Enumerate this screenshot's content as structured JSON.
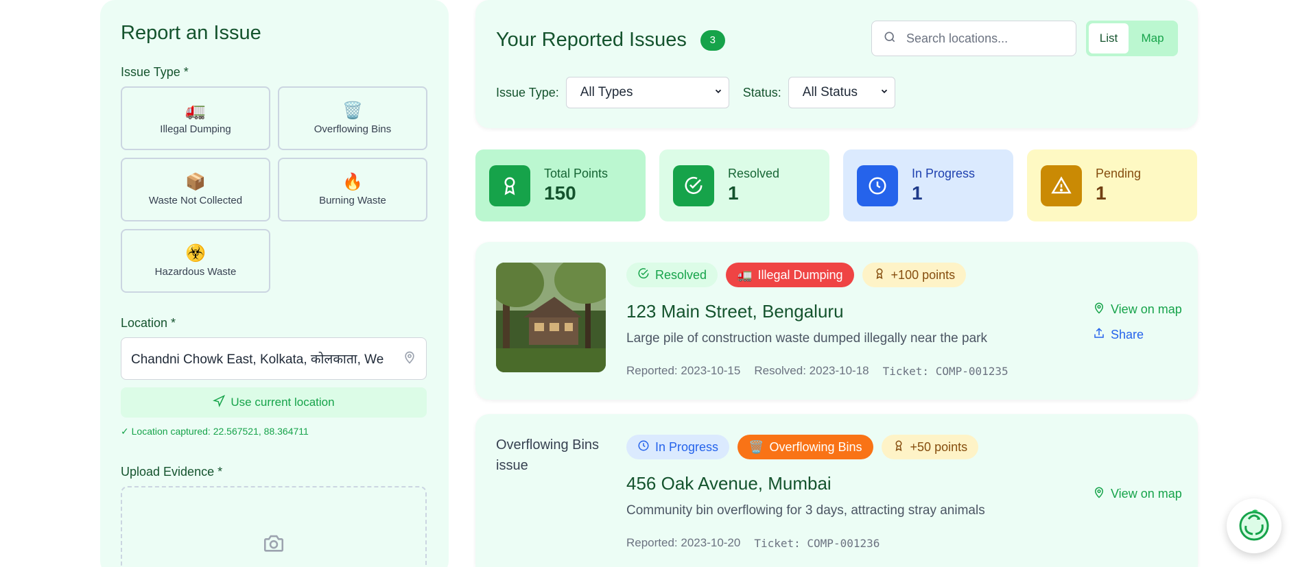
{
  "report_form": {
    "title": "Report an Issue",
    "issue_type_label": "Issue Type *",
    "issue_types": [
      {
        "label": "Illegal Dumping",
        "icon": "🚛"
      },
      {
        "label": "Overflowing Bins",
        "icon": "🗑️"
      },
      {
        "label": "Waste Not Collected",
        "icon": "📦"
      },
      {
        "label": "Burning Waste",
        "icon": "🔥"
      },
      {
        "label": "Hazardous Waste",
        "icon": "☣️"
      }
    ],
    "location_label": "Location *",
    "location_value": "Chandni Chowk East, Kolkata, कोलकाता, We",
    "use_location_label": "Use current location",
    "captured_text": "✓ Location captured: 22.567521, 88.364711",
    "upload_label": "Upload Evidence *"
  },
  "header": {
    "title": "Your Reported Issues",
    "count": "3",
    "search_placeholder": "Search locations...",
    "view_list": "List",
    "view_map": "Map",
    "issue_type_filter_label": "Issue Type:",
    "issue_type_filter_value": "All Types",
    "status_filter_label": "Status:",
    "status_filter_value": "All Status"
  },
  "stats": [
    {
      "label": "Total Points",
      "value": "150"
    },
    {
      "label": "Resolved",
      "value": "1"
    },
    {
      "label": "In Progress",
      "value": "1"
    },
    {
      "label": "Pending",
      "value": "1"
    }
  ],
  "issues": [
    {
      "status": "Resolved",
      "type": "Illegal Dumping",
      "type_icon": "🚛",
      "points": "+100 points",
      "address": "123 Main Street, Bengaluru",
      "description": "Large pile of construction waste dumped illegally near the park",
      "reported": "Reported: 2023-10-15",
      "resolved": "Resolved: 2023-10-18",
      "ticket": "Ticket: COMP-001235",
      "view_map": "View on map",
      "share": "Share"
    },
    {
      "status": "In Progress",
      "type": "Overflowing Bins",
      "type_icon": "🗑️",
      "points": "+50 points",
      "address": "456 Oak Avenue, Mumbai",
      "description": "Community bin overflowing for 3 days, attracting stray animals",
      "reported": "Reported: 2023-10-20",
      "ticket": "Ticket: COMP-001236",
      "image_alt": "Overflowing Bins issue",
      "view_map": "View on map"
    }
  ],
  "colors": {
    "brand_green": "#16a34a",
    "dark_green": "#14532d",
    "panel_bg": "#ecfdf5",
    "in_progress_blue": "#2563eb",
    "pending_amber": "#ca8a04",
    "illegal_dumping_red": "#ef4444",
    "overflowing_orange": "#f97316"
  }
}
